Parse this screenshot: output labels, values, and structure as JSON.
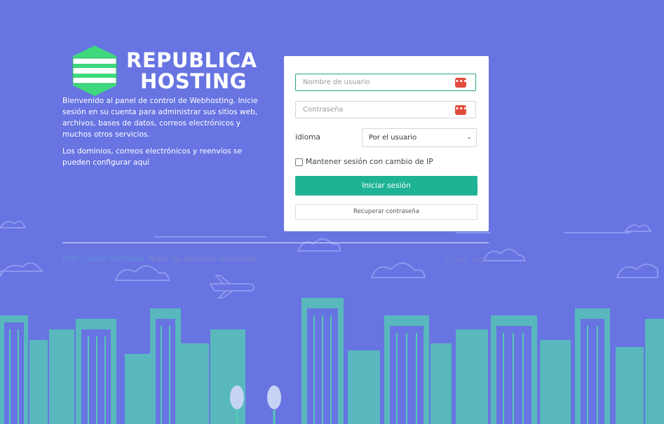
{
  "brand": {
    "line1": "REPUBLICA",
    "line2": "HOSTING"
  },
  "intro": {
    "paragraph1": "Bienvenido al panel de control de Webhosting. Inicie sesión en su cuenta para administrar sus sitios web, archivos, bases de datos, correos electrónicos y muchos otros servicios.",
    "paragraph2": "Los dominios, correos electrónicos y reenvíos se pueden configurar aquí"
  },
  "login": {
    "username_placeholder": "Nombre de usuario",
    "username_value": "",
    "password_placeholder": "Contraseña",
    "password_value": "",
    "password_manager_badge": "•••",
    "language_label": "idioma",
    "language_selected": "Por el usuario",
    "keep_session_label": "Mantener sesión con cambio de IP",
    "keep_session_checked": false,
    "login_button": "Iniciar sesión",
    "recover_button": "Recuperar contraseña"
  },
  "footer": {
    "link_text": "CWP Control WebPanel.",
    "rights_text": " Todos los derechos reservados",
    "copyright": "© 2013 - 2023"
  },
  "colors": {
    "background": "#6774e2",
    "accent": "#1db394",
    "skyline": "#55c9b4",
    "cloud": "#8d97ee",
    "logo_green": "#3ed87d"
  },
  "icons": {
    "logo": "server-stack-logo-icon",
    "password_manager": "password-manager-icon",
    "dropdown": "chevron-down-icon"
  }
}
